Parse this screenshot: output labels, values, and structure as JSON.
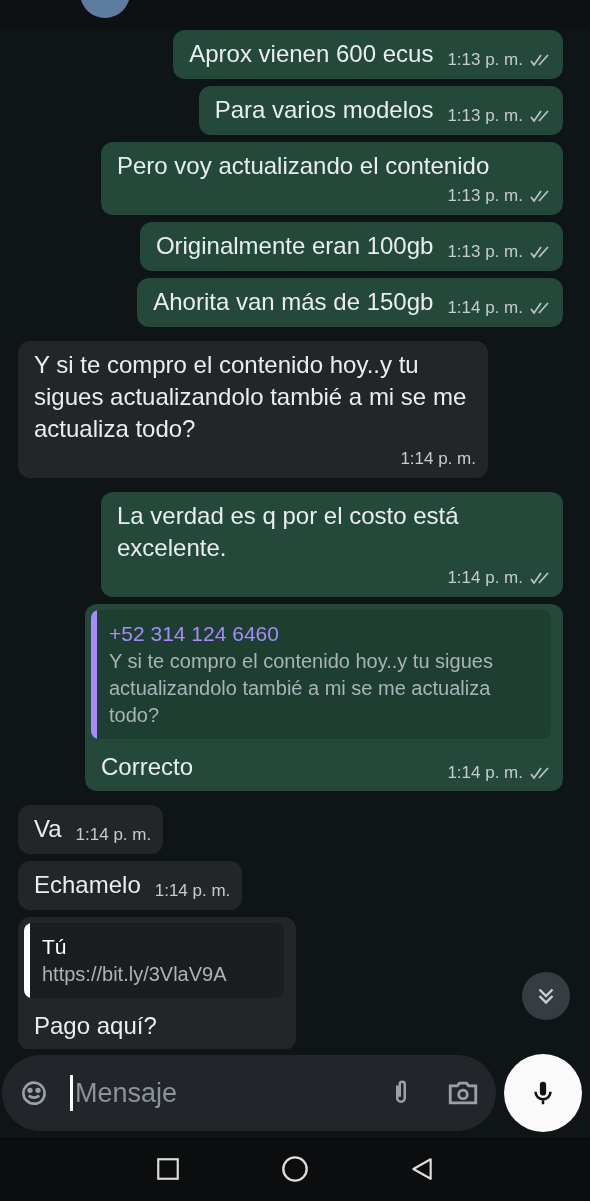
{
  "messages": [
    {
      "kind": "out",
      "text": "Aprox vienen 600 ecus",
      "time": "1:13 p. m.",
      "delivered": true
    },
    {
      "kind": "out",
      "text": "Para varios modelos",
      "time": "1:13 p. m.",
      "delivered": true
    },
    {
      "kind": "out",
      "text": "Pero voy actualizando el contenido",
      "time": "1:13 p. m.",
      "delivered": true
    },
    {
      "kind": "out",
      "text": "Originalmente eran 100gb",
      "time": "1:13 p. m.",
      "delivered": true
    },
    {
      "kind": "out",
      "text": "Ahorita van más de 150gb",
      "time": "1:14 p. m.",
      "delivered": true
    },
    {
      "kind": "in",
      "text": "Y si te compro el contenido hoy..y tu sigues actualizandolo tambié a mi se me actualiza todo?",
      "time": "1:14 p. m."
    },
    {
      "kind": "out",
      "text": "La verdad es q por el costo está excelente.",
      "time": "1:14 p. m.",
      "delivered": true
    },
    {
      "kind": "out",
      "quote": {
        "author": "+52 314 124 6460",
        "text": "Y si te compro el contenido hoy..y tu sigues actualizandolo tambié a mi se me actualiza todo?",
        "color": "#a78bfa"
      },
      "text": "Correcto",
      "time": "1:14 p. m.",
      "delivered": true
    },
    {
      "kind": "in",
      "text": "Va",
      "time": "1:14 p. m."
    },
    {
      "kind": "in",
      "text": "Echamelo",
      "time": "1:14 p. m."
    },
    {
      "kind": "in",
      "quote": {
        "author": "Tú",
        "text": "https://bit.ly/3VlaV9A",
        "color": "#ffffff"
      },
      "text": "Pago aquí?"
    }
  ],
  "composer": {
    "placeholder": "Mensaje"
  }
}
